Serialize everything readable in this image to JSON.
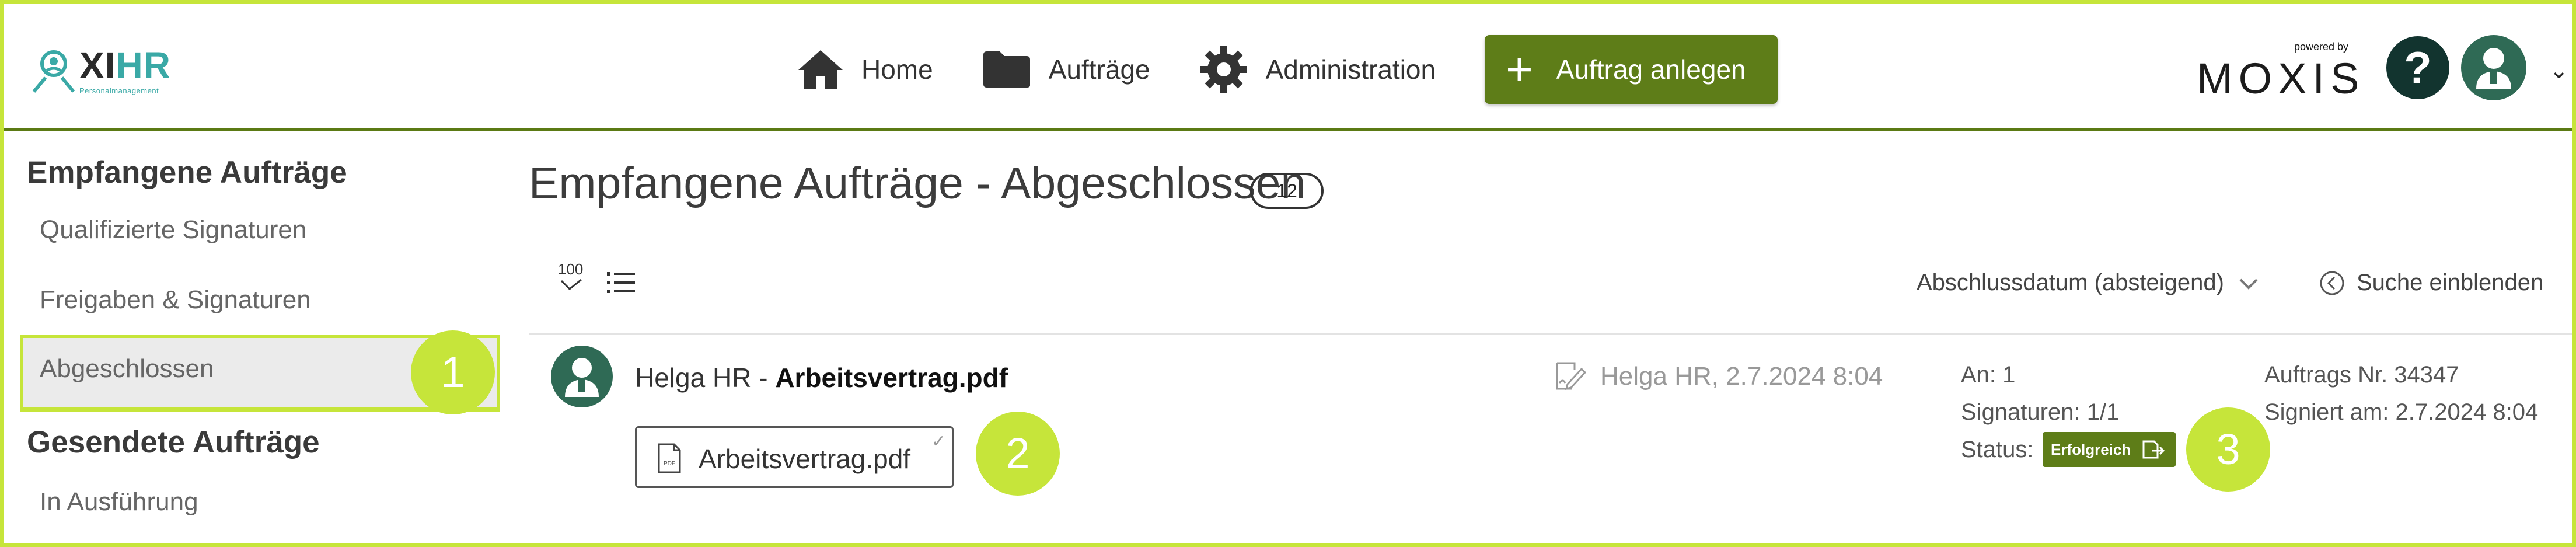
{
  "logo": {
    "main_a": "XI",
    "main_b": "HR",
    "sub": "Personalmanagement"
  },
  "nav": {
    "home": "Home",
    "orders": "Aufträge",
    "admin": "Administration",
    "new_order": "Auftrag anlegen"
  },
  "brand": {
    "powered_by": "powered by",
    "moxis": "MOXIS"
  },
  "help": "?",
  "sidebar": {
    "received_heading": "Empfangene Aufträge",
    "items": [
      {
        "label": "Qualifizierte Signaturen"
      },
      {
        "label": "Freigaben & Signaturen"
      },
      {
        "label": "Abgeschlossen"
      }
    ],
    "sent_heading": "Gesendete Aufträge",
    "sent_items": [
      {
        "label": "In Ausführung"
      }
    ]
  },
  "main": {
    "title": "Empfangene Aufträge - Abgeschlossen",
    "count": "12",
    "page_size": "100",
    "sort_label": "Abschlussdatum (absteigend)",
    "search_toggle": "Suche einblenden"
  },
  "row": {
    "sender": "Helga HR",
    "separator": " - ",
    "doc": "Arbeitsvertrag.pdf",
    "file_chip": "Arbeitsvertrag.pdf",
    "signed_info": "Helga HR, 2.7.2024 8:04",
    "recipients": "An: 1",
    "signatures": "Signaturen: 1/1",
    "status_label": "Status:",
    "status_value": "Erfolgreich",
    "order_no": "Auftrags Nr. 34347",
    "signed_at": "Signiert am: 2.7.2024 8:04"
  },
  "markers": [
    "1",
    "2",
    "3"
  ],
  "colors": {
    "accent": "#5e7d18",
    "highlight": "#c6e53a",
    "dark_teal": "#12342f",
    "avatar": "#2f6a55"
  }
}
